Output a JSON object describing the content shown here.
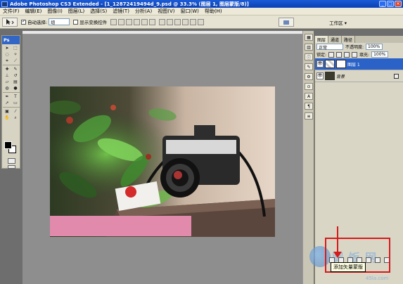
{
  "titlebar": {
    "title": "Adobe Photoshop CS3 Extended - [1_12872419494d_9.psd @ 33.3% (图层 1, 图层蒙版/8)]",
    "minimize": "_",
    "maximize": "□",
    "close": "×"
  },
  "menu": {
    "items": [
      "文件(F)",
      "编辑(E)",
      "图像(I)",
      "图层(L)",
      "选择(S)",
      "滤镜(T)",
      "分析(A)",
      "视图(V)",
      "窗口(W)",
      "帮助(H)"
    ]
  },
  "options": {
    "auto_select_label": "自动选择:",
    "auto_select_value": "组",
    "show_transform_label": "显示变换控件",
    "workspace_label": "工作区 ▾"
  },
  "toolbox": {
    "logo": "Ps"
  },
  "layers": {
    "tabs": [
      "图层",
      "通道",
      "路径"
    ],
    "blend_mode": "正常",
    "opacity_label": "不透明度:",
    "opacity_value": "100%",
    "lock_label": "锁定:",
    "fill_label": "填充:",
    "fill_value": "100%",
    "items": [
      {
        "name": "图层 1",
        "selected": true
      },
      {
        "name": "背景",
        "selected": false
      }
    ]
  },
  "tooltip": {
    "text": "添加矢量蒙版"
  },
  "watermark": {
    "text": "脚 饭 网",
    "sub": "45la.com"
  },
  "colors": {
    "titlebar": "#0a3fb3",
    "selection": "#2a62c8",
    "annotation_red": "#d51a1a",
    "pink_box": "#e28aac"
  }
}
